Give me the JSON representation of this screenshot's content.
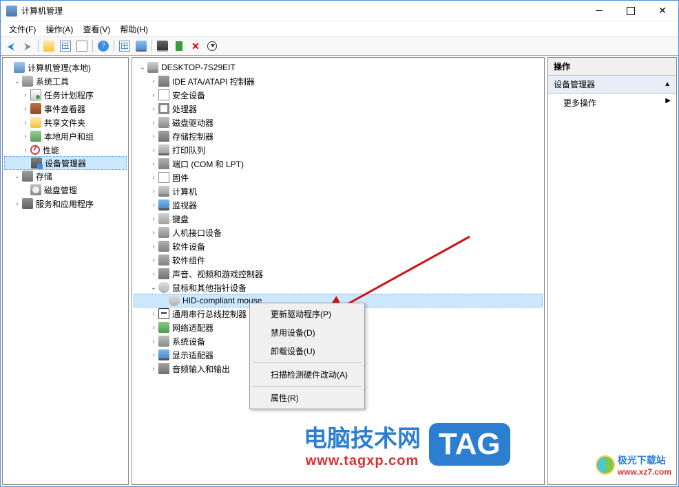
{
  "window": {
    "title": "计算机管理"
  },
  "menu": {
    "file": "文件(F)",
    "action": "操作(A)",
    "view": "查看(V)",
    "help": "帮助(H)"
  },
  "left_tree": {
    "root": "计算机管理(本地)",
    "sys_tools": "系统工具",
    "task_sched": "任务计划程序",
    "event_viewer": "事件查看器",
    "shared": "共享文件夹",
    "local_users": "本地用户和组",
    "perf": "性能",
    "dev_mgr": "设备管理器",
    "storage": "存储",
    "disk_mgmt": "磁盘管理",
    "svc_apps": "服务和应用程序"
  },
  "device_tree": {
    "root": "DESKTOP-7S29EIT",
    "ide": "IDE ATA/ATAPI 控制器",
    "sec": "安全设备",
    "cpu": "处理器",
    "disk_drive": "磁盘驱动器",
    "storage_ctrl": "存储控制器",
    "printers": "打印队列",
    "ports": "端口 (COM 和 LPT)",
    "firmware": "固件",
    "computer": "计算机",
    "monitors": "监视器",
    "keyboards": "键盘",
    "hid": "人机接口设备",
    "sw_dev": "软件设备",
    "sw_comp": "软件组件",
    "audio_ctrl": "声音、视频和游戏控制器",
    "mice": "鼠标和其他指针设备",
    "hid_mouse": "HID-compliant mouse",
    "usb_ctrl": "通用串行总线控制器",
    "net": "网络适配器",
    "sys_dev": "系统设备",
    "display": "显示适配器",
    "audio_io": "音频输入和输出"
  },
  "actions": {
    "title": "操作",
    "section": "设备管理器",
    "more": "更多操作"
  },
  "context_menu": {
    "update": "更新驱动程序(P)",
    "disable": "禁用设备(D)",
    "uninstall": "卸载设备(U)",
    "scan": "扫描检测硬件改动(A)",
    "props": "属性(R)"
  },
  "watermark": {
    "site_cn": "电脑技术网",
    "site_url": "www.tagxp.com",
    "tag": "TAG",
    "site2_cn": "极光下载站",
    "site2_url": "www.xz7.com"
  }
}
